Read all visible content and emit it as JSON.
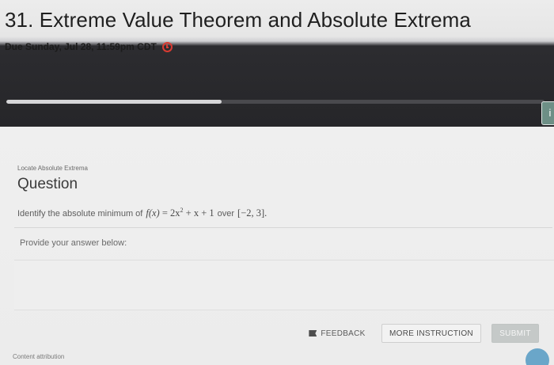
{
  "assignment": {
    "title": "31. Extreme Value Theorem and Absolute Extrema",
    "due": "Due Sunday, Jul 28, 11:59pm CDT",
    "progress_fraction": 0.4,
    "side_button_label": "i"
  },
  "question": {
    "topic": "Locate Absolute Extrema",
    "heading": "Question",
    "prompt_before": "Identify the absolute minimum of",
    "function_lhs": "f(x)",
    "function_rhs_a": "= 2x",
    "function_exp": "2",
    "function_rhs_b": " + x + 1",
    "prompt_over": "over",
    "interval": "[−2, 3].",
    "answer_label": "Provide your answer below:"
  },
  "actions": {
    "feedback": "FEEDBACK",
    "more_instruction": "MORE INSTRUCTION",
    "submit": "SUBMIT"
  },
  "footer": {
    "content_attribution": "Content attribution"
  },
  "colors": {
    "header_dark": "#262629",
    "deadline_icon": "#d93b32",
    "submit_disabled": "#c5c9c8",
    "help_bubble": "#6aa6c9"
  }
}
